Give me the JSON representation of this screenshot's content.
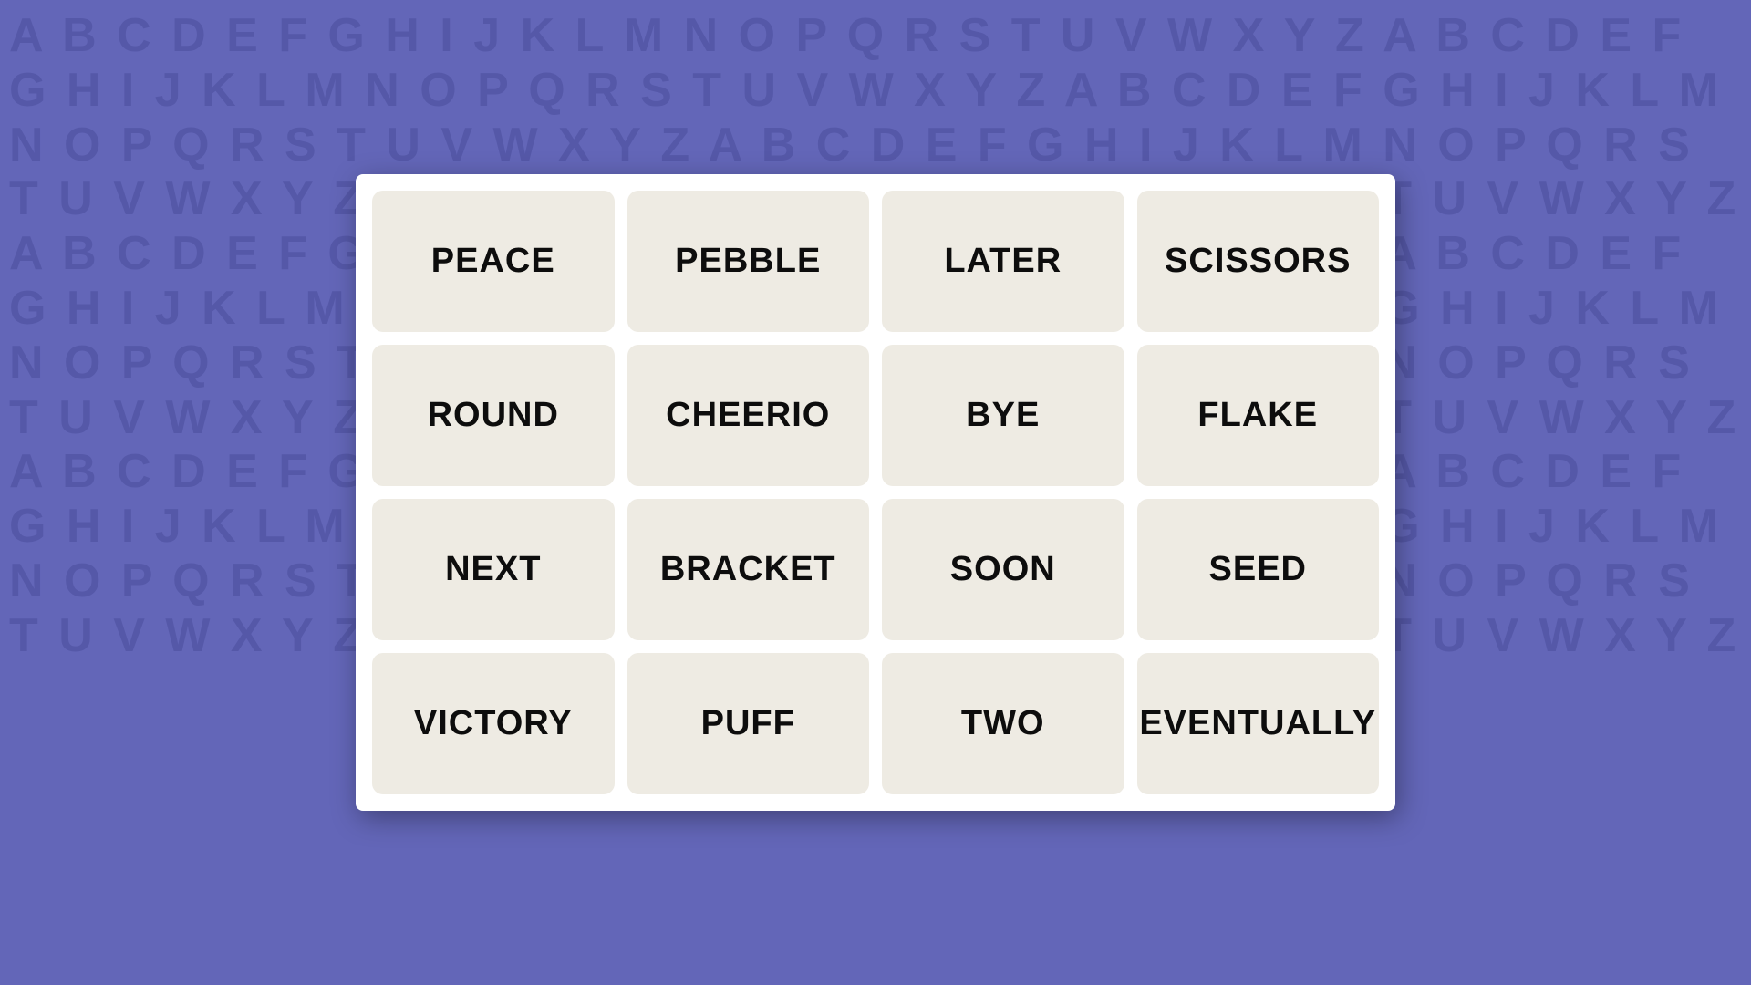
{
  "background": {
    "alphabet_text": "A B C D E F G H I J K L M N O P Q R S T U V W X Y Z A B C D E F G H I J K L M N O P Q R S T U V W X Y Z A B C D E F G H I J K L M N O P Q R S T U V W X Y Z A B C D E F G H I J K L M N O P Q R S T U V W X Y Z A B C D E F G H I J K L M N O P Q R S T U V W X Y Z A B C D E F G H I J K L M N O P Q R S T U V W X Y Z A B C D E F G H I J K L M N O P Q R S T U V W X Y Z A B C D E F G H I J K L M N O P Q R S T U V W X Y Z A B C D E F G H I J K L M N O P Q R S T U V W X Y Z A B C D E F G H I J K L M N O P Q R S T U V W X Y Z A B C D E F G H I J K L M N O P Q R S T U V W X Y Z A B C D E F G H I J K L M N O P Q R S T U V W X Y Z A B C D E F G H I J K L M N O P Q R S T U V W X Y Z A B C D E F G H I J K L M N O P Q R S T U V W X Y Z A B C D E F G H I J K L M N O P Q R S T U V W X Y Z"
  },
  "grid": {
    "words": [
      "PEACE",
      "PEBBLE",
      "LATER",
      "SCISSORS",
      "ROUND",
      "CHEERIO",
      "BYE",
      "FLAKE",
      "NEXT",
      "BRACKET",
      "SOON",
      "SEED",
      "VICTORY",
      "PUFF",
      "TWO",
      "EVENTUALLY"
    ]
  }
}
